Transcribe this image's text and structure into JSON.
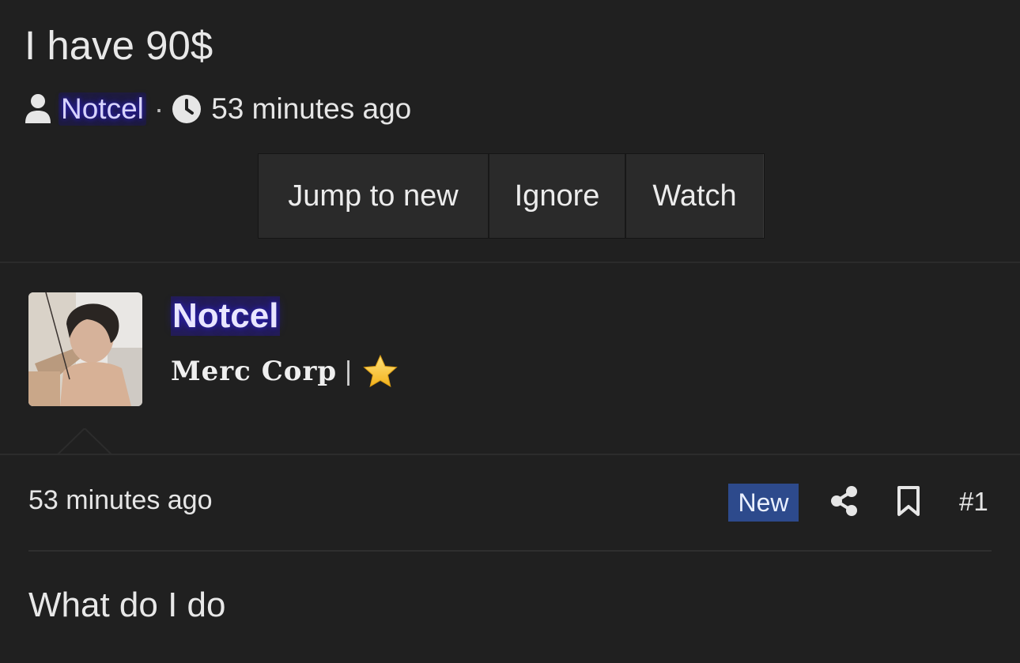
{
  "thread": {
    "title": "I have 90$",
    "author": "Notcel",
    "separator": "·",
    "time": "53 minutes ago",
    "buttons": {
      "jump": "Jump to new",
      "ignore": "Ignore",
      "watch": "Watch"
    }
  },
  "post": {
    "author": "Notcel",
    "user_title": "Merc Corp",
    "title_separator": "|",
    "time": "53 minutes ago",
    "badge": "New",
    "number": "#1",
    "body": "What do I do"
  },
  "colors": {
    "background": "#202020",
    "button": "#2a2a2a",
    "username_glow": "#2a1fb0",
    "badge": "#2d4a8c",
    "star": "#f7c531"
  },
  "icons": [
    "user-icon",
    "clock-icon",
    "star-icon",
    "share-icon",
    "bookmark-icon"
  ]
}
